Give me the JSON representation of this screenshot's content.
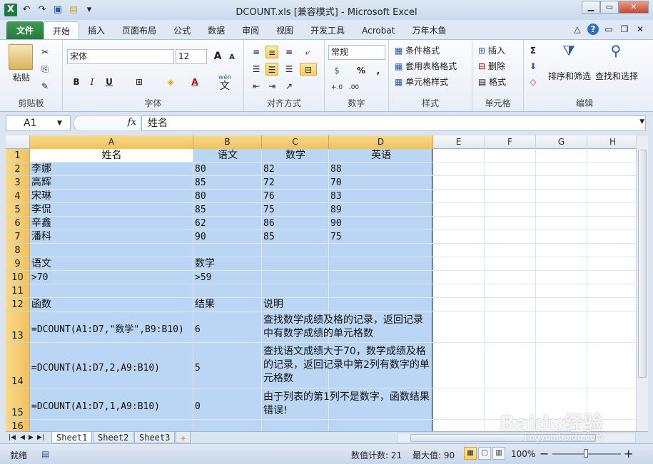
{
  "window": {
    "title": "DCOUNT.xls  [兼容模式] - Microsoft Excel",
    "min": "▁",
    "max": "▭",
    "close": "✕"
  },
  "qat": {
    "app_icon": "X",
    "undo": "↶",
    "redo": "↷",
    "save": "▣",
    "open": "▤",
    "more": "▾"
  },
  "tabs": [
    "文件",
    "开始",
    "插入",
    "页面布局",
    "公式",
    "数据",
    "审阅",
    "视图",
    "开发工具",
    "Acrobat",
    "万年木鱼"
  ],
  "tabs_right": {
    "up": "△",
    "help": "?",
    "min": "▭",
    "restore": "❐",
    "close": "✕"
  },
  "ribbon": {
    "clipboard": {
      "paste": "粘贴",
      "label": "剪贴板"
    },
    "font": {
      "name": "宋体",
      "size": "12",
      "grow": "A",
      "shrink": "A",
      "bold": "B",
      "italic": "I",
      "underline": "U",
      "border": "⊞",
      "fill": "◈",
      "color": "A",
      "wen": "wén",
      "wen_char": "文",
      "label": "字体"
    },
    "align": {
      "label": "对齐方式"
    },
    "number": {
      "format": "常规",
      "pct": "%",
      "comma": ",",
      "label": "数字"
    },
    "styles": {
      "cond": "条件格式",
      "table": "套用表格格式",
      "cell": "单元格样式",
      "label": "样式"
    },
    "cells": {
      "insert": "插入",
      "delete": "删除",
      "format": "格式",
      "label": "单元格"
    },
    "editing": {
      "sort": "排序和筛选",
      "find": "查找和选择",
      "sigma": "Σ",
      "label": "编辑"
    }
  },
  "formula": {
    "namebox": "A1",
    "fx": "fx",
    "value": "姓名"
  },
  "columns": [
    "A",
    "B",
    "C",
    "D",
    "E",
    "F",
    "G",
    "H"
  ],
  "rows": [
    "1",
    "2",
    "3",
    "4",
    "5",
    "6",
    "7",
    "8",
    "9",
    "10",
    "11",
    "12",
    "13",
    "14",
    "15",
    "16"
  ],
  "cells": {
    "A1": "姓名",
    "B1": "语文",
    "C1": "数学",
    "D1": "英语",
    "A2": "李娜",
    "B2": "80",
    "C2": "82",
    "D2": "88",
    "A3": "高辉",
    "B3": "85",
    "C3": "72",
    "D3": "70",
    "A4": "宋琳",
    "B4": "80",
    "C4": "76",
    "D4": "83",
    "A5": "李侃",
    "B5": "85",
    "C5": "75",
    "D5": "89",
    "A6": "辛鑫",
    "B6": "62",
    "C6": "86",
    "D6": "90",
    "A7": "潘科",
    "B7": "90",
    "C7": "85",
    "D7": "75",
    "A9": "语文",
    "B9": "数学",
    "A10": ">70",
    "B10": ">59",
    "A12": "函数",
    "B12": "结果",
    "C12": "说明",
    "A13": "=DCOUNT(A1:D7,\"数学\",B9:B10)",
    "B13": "6",
    "C13": "查找数学成绩及格的记录，返回记录中有数学成绩的单元格数",
    "A14": "=DCOUNT(A1:D7,2,A9:B10)",
    "B14": "5",
    "C14": "查找语文成绩大于70，数学成绩及格的记录，返回记录中第2列有数字的单元格数",
    "A15": "=DCOUNT(A1:D7,1,A9:B10)",
    "B15": "0",
    "C15": "由于列表的第1列不是数字，函数结果错误!"
  },
  "sheets": [
    "Sheet1",
    "Sheet2",
    "Sheet3"
  ],
  "status": {
    "ready": "就绪",
    "count": "数值计数: 21",
    "max": "最大值: 90",
    "zoom": "100%",
    "minus": "−",
    "plus": "+"
  },
  "watermark": {
    "logo": "Baidu经验",
    "url": "jingyan.baidu.com"
  }
}
